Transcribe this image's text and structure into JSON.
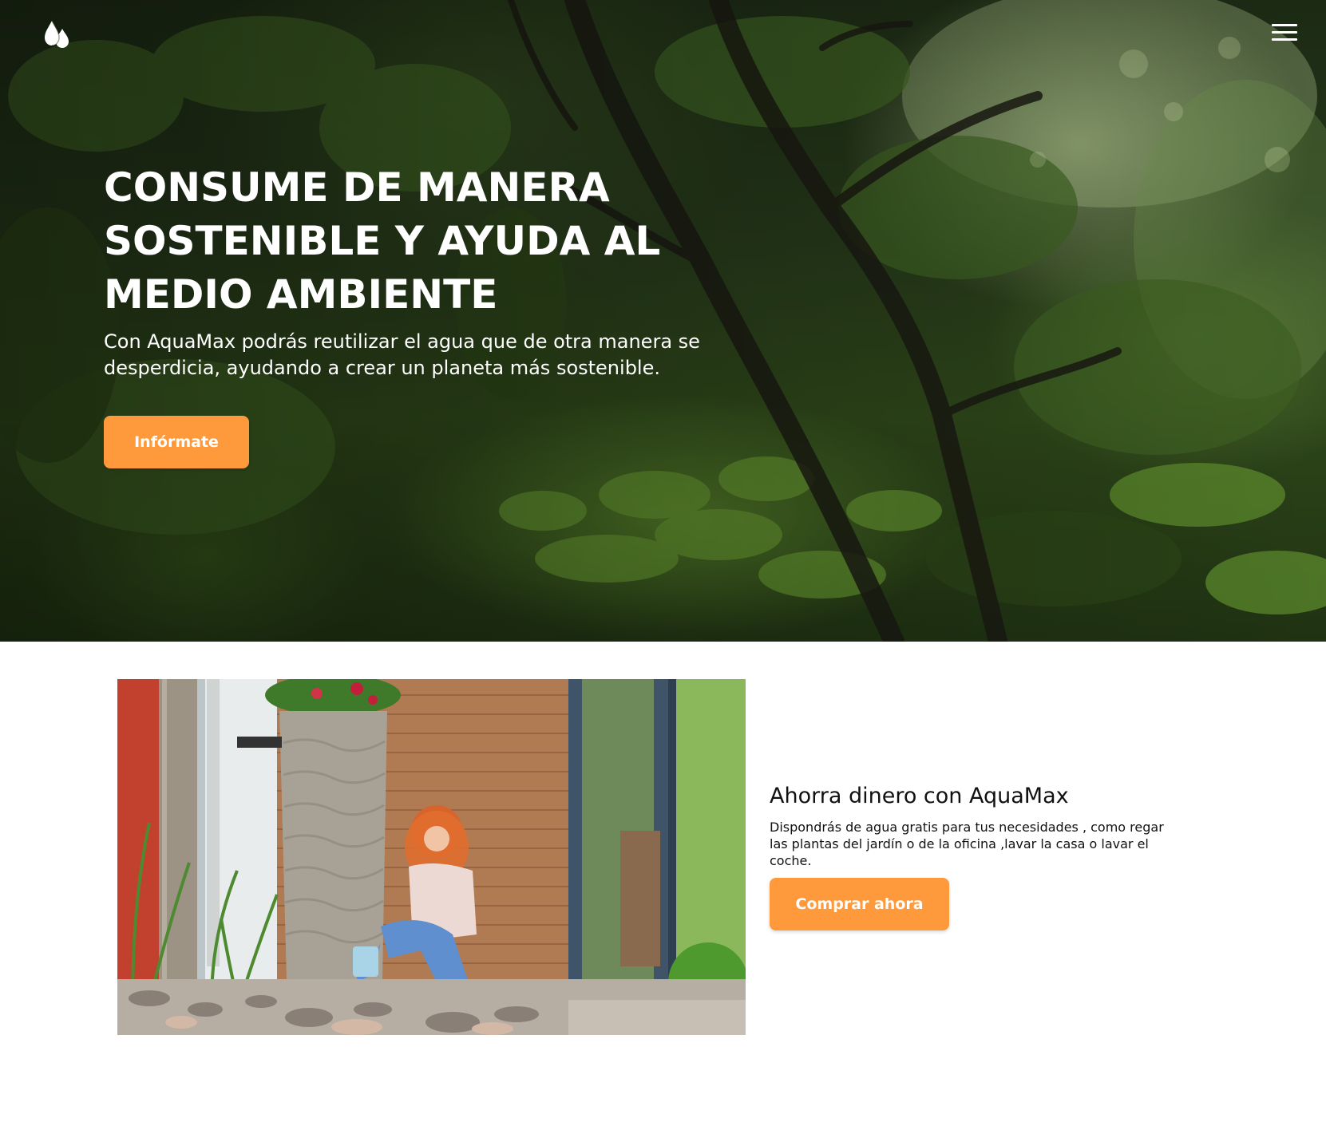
{
  "header": {
    "logo_icon": "water-drops-icon",
    "menu_icon": "hamburger-menu-icon"
  },
  "hero": {
    "title": "CONSUME DE MANERA SOSTENIBLE Y AYUDA AL MEDIO AMBIENTE",
    "text": "Con AquaMax podrás reutilizar el agua que de otra manera se desperdicia, ayudando a crear un planeta más sostenible.",
    "button_label": "Infórmate",
    "background": "forest-photo"
  },
  "feature": {
    "image": "woman-sitting-by-rain-water-tank-photo",
    "title": "Ahorra dinero con AquaMax",
    "text": "Dispondrás de agua gratis para tus necesidades , como regar las plantas del jardín o de la oficina ,lavar la casa o lavar el coche.",
    "button_label": "Comprar ahora"
  },
  "colors": {
    "accent": "#ff9a3c",
    "text_dark": "#111111",
    "text_light": "#ffffff"
  }
}
